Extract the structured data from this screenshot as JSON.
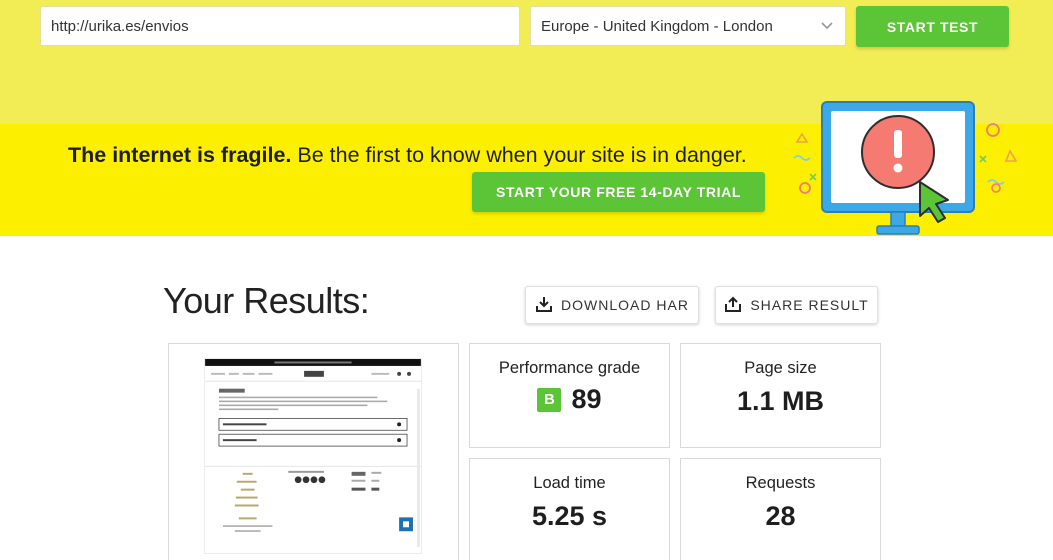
{
  "test_form": {
    "url_value": "http://urika.es/envios",
    "region_selected": "Europe - United Kingdom - London",
    "start_label": "START TEST"
  },
  "promo": {
    "headline_bold": "The internet is fragile.",
    "headline_rest": " Be the first to know when your site is in danger.",
    "cta_label": "START YOUR FREE 14-DAY TRIAL"
  },
  "results": {
    "title": "Your Results:",
    "download_label": "DOWNLOAD HAR",
    "share_label": "SHARE RESULT"
  },
  "metrics": {
    "performance": {
      "label": "Performance grade",
      "grade": "B",
      "score": "89"
    },
    "page_size": {
      "label": "Page size",
      "value": "1.1 MB"
    },
    "load_time": {
      "label": "Load time",
      "value": "5.25 s"
    },
    "requests": {
      "label": "Requests",
      "value": "28"
    }
  },
  "colors": {
    "top_bar": "#f2ec55",
    "promo_band": "#fcf000",
    "accent_green": "#5cc437",
    "monitor_blue": "#3da8e8",
    "alert_red": "#f47a72"
  }
}
